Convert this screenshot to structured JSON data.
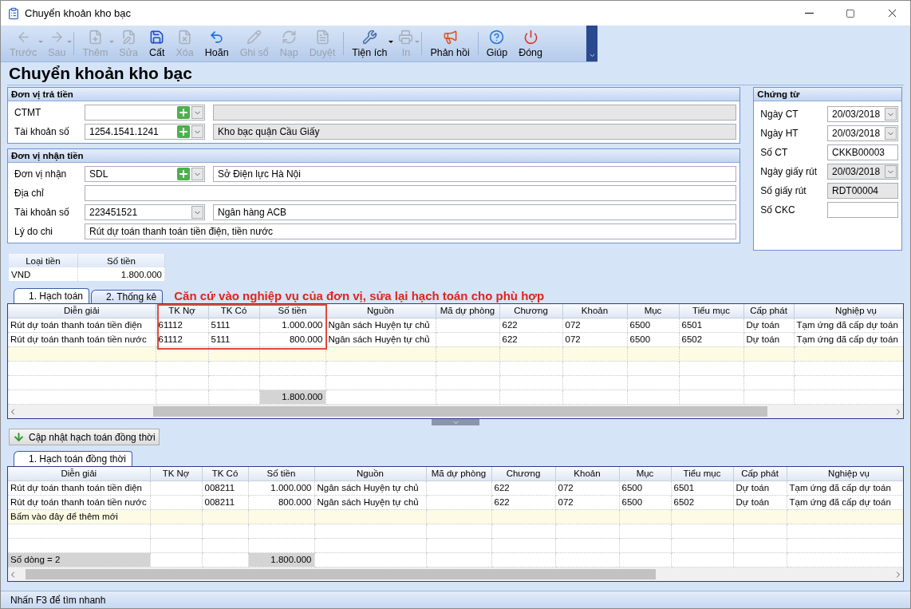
{
  "window": {
    "title": "Chuyển khoản kho bạc"
  },
  "toolbar": [
    {
      "label": "Trước",
      "disabled": true,
      "dropdown": true
    },
    {
      "label": "Sau",
      "disabled": true,
      "dropdown": true
    },
    {
      "label": "Thêm",
      "disabled": true,
      "dropdown": true
    },
    {
      "label": "Sửa",
      "disabled": true,
      "dropdown": false
    },
    {
      "label": "Cất",
      "disabled": false,
      "dropdown": false
    },
    {
      "label": "Xóa",
      "disabled": true,
      "dropdown": false
    },
    {
      "label": "Hoãn",
      "disabled": false,
      "dropdown": false
    },
    {
      "label": "Ghi sổ",
      "disabled": true,
      "dropdown": false
    },
    {
      "label": "Nạp",
      "disabled": true,
      "dropdown": false
    },
    {
      "label": "Duyệt",
      "disabled": true,
      "dropdown": false
    },
    {
      "label": "Tiện ích",
      "disabled": false,
      "dropdown": true
    },
    {
      "label": "In",
      "disabled": true,
      "dropdown": true
    },
    {
      "label": "Phản hồi",
      "disabled": false,
      "dropdown": false
    },
    {
      "label": "Giúp",
      "disabled": false,
      "dropdown": false
    },
    {
      "label": "Đóng",
      "disabled": false,
      "dropdown": false
    }
  ],
  "page_title": "Chuyển khoản kho bạc",
  "payer": {
    "title": "Đơn vị trả tiền",
    "fields": [
      {
        "label": "CTMT",
        "kind": "lookup",
        "detail_readonly": true
      },
      {
        "label": "Tài khoản số",
        "value": "1254.1541.1241",
        "kind": "lookup",
        "detail": "Kho bạc quận Cầu Giấy",
        "detail_readonly": true
      }
    ]
  },
  "payee": {
    "title": "Đơn vị nhận tiền",
    "fields": [
      {
        "label": "Đơn vị nhận",
        "value": "SDL",
        "kind": "lookup",
        "detail": "Sở Điện lực Hà Nội",
        "detail_readonly": false
      },
      {
        "label": "Địa chỉ",
        "kind": "text"
      },
      {
        "label": "Tài khoản số",
        "value": "223451521",
        "kind": "combo",
        "detail": "Ngân hàng ACB",
        "detail_readonly": false
      },
      {
        "label": "Lý do chi",
        "value": "Rút dự toán thanh toán tiền điện, tiền nước",
        "kind": "text"
      }
    ]
  },
  "voucher": {
    "title": "Chứng từ",
    "fields": [
      {
        "label": "Ngày CT",
        "value": "20/03/2018",
        "kind": "date",
        "readonly": false
      },
      {
        "label": "Ngày HT",
        "value": "20/03/2018",
        "kind": "date",
        "readonly": false
      },
      {
        "label": "Số CT",
        "value": "CKKB00003",
        "kind": "text",
        "readonly": false
      },
      {
        "label": "Ngày giấy rút",
        "value": "20/03/2018",
        "kind": "date",
        "readonly": true
      },
      {
        "label": "Số giấy rút",
        "value": "RDT00004",
        "kind": "text",
        "readonly": true
      },
      {
        "label": "Số CKC",
        "kind": "text",
        "readonly": false
      }
    ]
  },
  "currency_table": {
    "columns": [
      "Loại tiền",
      "Số tiền"
    ],
    "rows": [
      [
        "VND",
        "1.800.000"
      ]
    ]
  },
  "tabs": [
    {
      "label": "1. Hạch toán",
      "selected": true
    },
    {
      "label": "2. Thống kê",
      "selected": false
    }
  ],
  "note": "Căn cứ vào nghiệp vụ của đơn vị, sửa lại hạch toán cho phù hợp",
  "entries_grid": {
    "columns": [
      {
        "label": "Diễn giải",
        "kind": "text",
        "highlighted": false
      },
      {
        "label": "TK Nợ",
        "kind": "text",
        "highlighted": true
      },
      {
        "label": "TK Có",
        "kind": "text",
        "highlighted": true
      },
      {
        "label": "Số tiền",
        "kind": "amount",
        "highlighted": true
      },
      {
        "label": "Nguồn",
        "kind": "text",
        "highlighted": false
      },
      {
        "label": "Mã dự phòng",
        "kind": "text",
        "highlighted": false
      },
      {
        "label": "Chương",
        "kind": "text",
        "highlighted": false
      },
      {
        "label": "Khoản",
        "kind": "text",
        "highlighted": false
      },
      {
        "label": "Mục",
        "kind": "text",
        "highlighted": false
      },
      {
        "label": "Tiểu mục",
        "kind": "text",
        "highlighted": false
      },
      {
        "label": "Cấp phát",
        "kind": "text",
        "highlighted": false
      },
      {
        "label": "Nghiệp vụ",
        "kind": "text",
        "highlighted": false
      }
    ],
    "rows": [
      [
        "Rút dự toán thanh toán tiền điện",
        "61112",
        "5111",
        "1.000.000",
        "Ngân sách Huyện tự chủ",
        "",
        "622",
        "072",
        "6500",
        "6501",
        "Dự toán",
        "Tạm ứng đã cấp dự toán"
      ],
      [
        "Rút dự toán thanh toán tiền nước",
        "61112",
        "5111",
        "800.000",
        "Ngân sách Huyện tự chủ",
        "",
        "622",
        "072",
        "6500",
        "6502",
        "Dự toán",
        "Tạm ứng đã cấp dự toán"
      ]
    ],
    "footer": {
      "total": "1.800.000"
    }
  },
  "update_button": "Cập nhật hạch toán đồng thời",
  "tabs2": [
    {
      "label": "1. Hạch toán đồng thời",
      "selected": true
    }
  ],
  "concurrent_grid": {
    "columns": [
      {
        "label": "Diễn giải",
        "kind": "text",
        "highlighted": false
      },
      {
        "label": "TK Nợ",
        "kind": "text",
        "highlighted": false
      },
      {
        "label": "TK Có",
        "kind": "text",
        "highlighted": false
      },
      {
        "label": "Số tiền",
        "kind": "amount",
        "highlighted": false
      },
      {
        "label": "Nguồn",
        "kind": "text",
        "highlighted": false
      },
      {
        "label": "Mã dự phòng",
        "kind": "text",
        "highlighted": false
      },
      {
        "label": "Chương",
        "kind": "text",
        "highlighted": false
      },
      {
        "label": "Khoản",
        "kind": "text",
        "highlighted": false
      },
      {
        "label": "Mục",
        "kind": "text",
        "highlighted": false
      },
      {
        "label": "Tiểu mục",
        "kind": "text",
        "highlighted": false
      },
      {
        "label": "Cấp phát",
        "kind": "text",
        "highlighted": false
      },
      {
        "label": "Nghiệp vụ",
        "kind": "text",
        "highlighted": false
      }
    ],
    "rows": [
      [
        "Rút dự toán thanh toán tiền điện",
        "",
        "008211",
        "1.000.000",
        "Ngân sách Huyện tự chủ",
        "",
        "622",
        "072",
        "6500",
        "6501",
        "Dự toán",
        "Tạm ứng đã cấp dự toán"
      ],
      [
        "Rút dự toán thanh toán tiền nước",
        "",
        "008211",
        "800.000",
        "Ngân sách Huyện tự chủ",
        "",
        "622",
        "072",
        "6500",
        "6502",
        "Dự toán",
        "Tạm ứng đã cấp dự toán"
      ]
    ],
    "new_row_hint": "Bấm vào đây để thêm mới",
    "footer": {
      "count": "Số dòng = 2",
      "total": "1.800.000"
    }
  },
  "status_bar": "Nhấn F3 để tìm nhanh"
}
